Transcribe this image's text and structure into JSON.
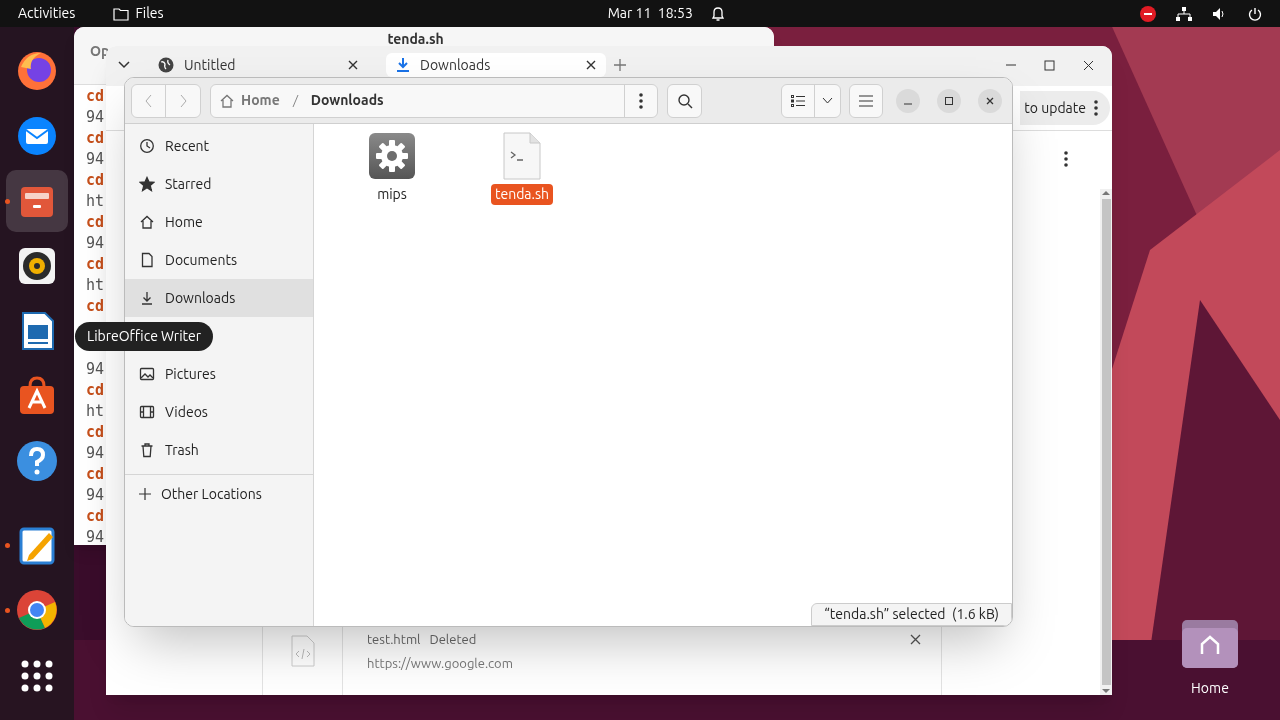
{
  "top_bar": {
    "activities": "Activities",
    "app": "Files",
    "clock": "Mar 11  18:53"
  },
  "dock": [
    {
      "kind": "firefox",
      "running": false,
      "selected": false
    },
    {
      "kind": "mail",
      "running": false,
      "selected": false
    },
    {
      "kind": "files",
      "running": true,
      "selected": true
    },
    {
      "kind": "music",
      "running": false,
      "selected": false
    },
    {
      "kind": "writer",
      "running": false,
      "selected": false
    },
    {
      "kind": "store",
      "running": false,
      "selected": false
    },
    {
      "kind": "help",
      "running": false,
      "selected": false
    },
    {
      "kind": "editor",
      "running": true,
      "selected": false
    },
    {
      "kind": "chrome",
      "running": true,
      "selected": false
    },
    {
      "kind": "grid",
      "running": false,
      "selected": false
    }
  ],
  "tooltip": "LibreOffice Writer",
  "editor": {
    "menu": "Op",
    "title": "tenda.sh",
    "lines_top": [
      {
        "text": "cd",
        "kind": "command"
      },
      {
        "text": "94",
        "kind": "output"
      },
      {
        "text": "cd",
        "kind": "command"
      },
      {
        "text": "94",
        "kind": "output"
      },
      {
        "text": "cd",
        "kind": "command"
      },
      {
        "text": "ht",
        "kind": "output"
      },
      {
        "text": "cd",
        "kind": "command"
      },
      {
        "text": "94",
        "kind": "output"
      },
      {
        "text": "cd",
        "kind": "command"
      },
      {
        "text": "ht",
        "kind": "output"
      },
      {
        "text": "cd",
        "kind": "command"
      }
    ],
    "lines_bottom": [
      {
        "text": "94",
        "kind": "output"
      },
      {
        "text": "cd",
        "kind": "command"
      },
      {
        "text": "ht",
        "kind": "output"
      },
      {
        "text": "cd",
        "kind": "command"
      },
      {
        "text": "94",
        "kind": "output"
      },
      {
        "text": "cd",
        "kind": "command"
      },
      {
        "text": "94",
        "kind": "output"
      },
      {
        "text": "cd",
        "kind": "command"
      },
      {
        "text": "94",
        "kind": "output"
      }
    ]
  },
  "browser": {
    "tabs": [
      {
        "title": "Untitled",
        "kind": "web",
        "selected": false
      },
      {
        "title": "Downloads",
        "kind": "download",
        "selected": true
      }
    ],
    "update": "to update",
    "download": {
      "name": "test.html",
      "status": "Deleted",
      "url": "https://www.google.com"
    }
  },
  "files": {
    "path": [
      "Home",
      "Downloads"
    ],
    "sidebar_top": [
      {
        "label": "Recent",
        "kind": "recent",
        "selected": false
      },
      {
        "label": "Starred",
        "kind": "star",
        "selected": false
      },
      {
        "label": "Home",
        "kind": "home",
        "selected": false
      },
      {
        "label": "Documents",
        "kind": "doc",
        "selected": false
      },
      {
        "label": "Downloads",
        "kind": "download",
        "selected": true
      }
    ],
    "sidebar_bottom": [
      {
        "label": "Pictures",
        "kind": "picture",
        "selected": false
      },
      {
        "label": "Videos",
        "kind": "video",
        "selected": false
      },
      {
        "label": "Trash",
        "kind": "trash",
        "selected": false
      }
    ],
    "other": "Other Locations",
    "items": [
      {
        "name": "mips",
        "kind": "executable",
        "selected": false
      },
      {
        "name": "tenda.sh",
        "kind": "script",
        "selected": true
      }
    ],
    "status": "“tenda.sh” selected  (1.6 kB)"
  },
  "desktop_icons": [
    {
      "label": "Home"
    }
  ]
}
